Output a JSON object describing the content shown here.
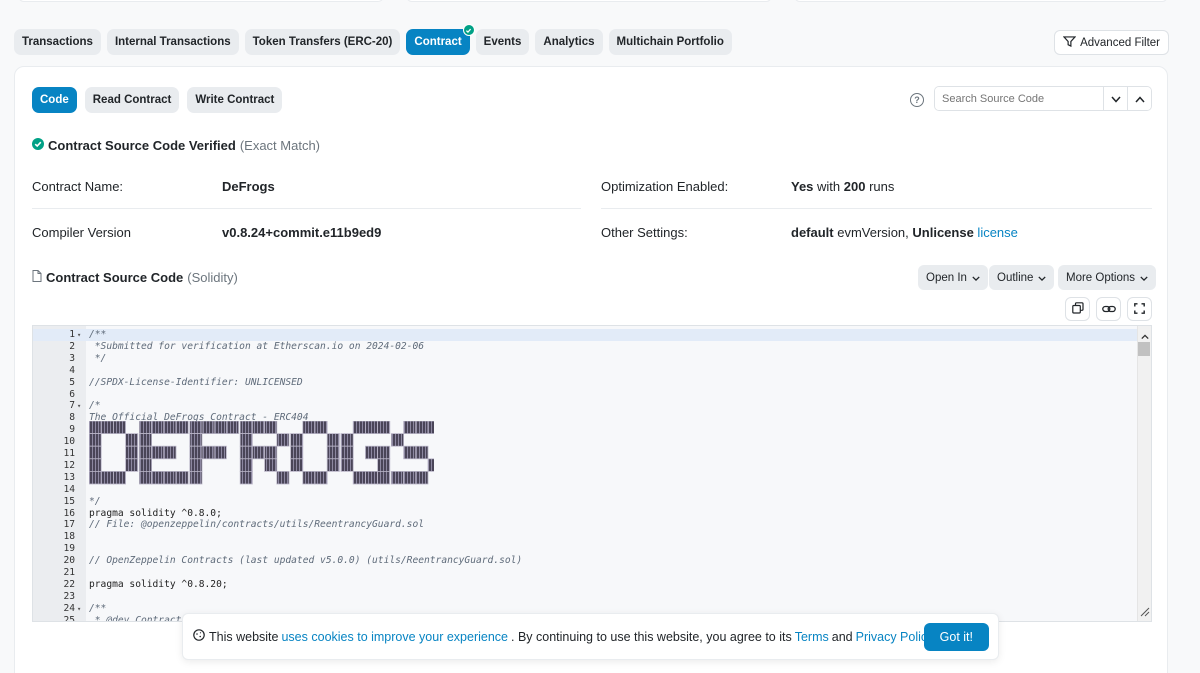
{
  "tabs": [
    "Transactions",
    "Internal Transactions",
    "Token Transfers (ERC-20)",
    "Contract",
    "Events",
    "Analytics",
    "Multichain Portfolio"
  ],
  "active_tab": "Contract",
  "advanced_filter": "Advanced Filter",
  "subtabs": [
    "Code",
    "Read Contract",
    "Write Contract"
  ],
  "search": {
    "placeholder": "Search Source Code"
  },
  "verified": {
    "title": "Contract Source Code Verified",
    "note": "(Exact Match)"
  },
  "info": {
    "contract_name_label": "Contract Name:",
    "contract_name": "DeFrogs",
    "compiler_label": "Compiler Version",
    "compiler": "v0.8.24+commit.e11b9ed9",
    "optimization_label": "Optimization Enabled:",
    "optimization_yes": "Yes",
    "optimization_with": " with ",
    "optimization_runs": "200",
    "optimization_runs_suffix": " runs",
    "other_label": "Other Settings:",
    "other_default": "default",
    "other_evm": " evmVersion, ",
    "other_unlicense": "Unlicense",
    "other_license": " license"
  },
  "source": {
    "title": "Contract Source Code",
    "lang": "(Solidity)",
    "open_in": "Open In",
    "outline": "Outline",
    "more_options": "More Options"
  },
  "code_lines": [
    {
      "n": "1",
      "fold": true,
      "t": "/**",
      "c": true
    },
    {
      "n": "2",
      "t": " *Submitted for verification at Etherscan.io on 2024-02-06",
      "c": true
    },
    {
      "n": "3",
      "t": " */",
      "c": true
    },
    {
      "n": "4",
      "t": ""
    },
    {
      "n": "5",
      "t": "//SPDX-License-Identifier: UNLICENSED",
      "c": true
    },
    {
      "n": "6",
      "t": ""
    },
    {
      "n": "7",
      "fold": true,
      "t": "/*",
      "c": true
    },
    {
      "n": "8",
      "t": "The Official DeFrogs Contract - ERC404",
      "c": true
    },
    {
      "n": "9",
      "t": ""
    },
    {
      "n": "10",
      "t": ""
    },
    {
      "n": "11",
      "t": ""
    },
    {
      "n": "12",
      "t": ""
    },
    {
      "n": "13",
      "t": ""
    },
    {
      "n": "14",
      "t": ""
    },
    {
      "n": "15",
      "t": "*/",
      "c": true
    },
    {
      "n": "16",
      "t": "pragma solidity ^0.8.0;"
    },
    {
      "n": "17",
      "t": "// File: @openzeppelin/contracts/utils/ReentrancyGuard.sol",
      "c": true
    },
    {
      "n": "18",
      "t": ""
    },
    {
      "n": "19",
      "t": ""
    },
    {
      "n": "20",
      "t": "// OpenZeppelin Contracts (last updated v5.0.0) (utils/ReentrancyGuard.sol)",
      "c": true
    },
    {
      "n": "21",
      "t": ""
    },
    {
      "n": "22",
      "t": "pragma solidity ^0.8.20;"
    },
    {
      "n": "23",
      "t": ""
    },
    {
      "n": "24",
      "fold": true,
      "t": "/**",
      "c": true
    },
    {
      "n": "25",
      "t": " * @dev Contract",
      "c": true
    }
  ],
  "ascii_art_text": "DEFROGS",
  "cookie": {
    "pre": "This website",
    "link1": "uses cookies to improve your experience",
    "mid": ". By continuing to use this website, you agree to its",
    "terms": "Terms",
    "and": "and",
    "privacy": "Privacy Policy",
    "dot": ".",
    "button": "Got it!"
  },
  "colors": {
    "accent": "#0784c3",
    "verified": "#00a186"
  }
}
